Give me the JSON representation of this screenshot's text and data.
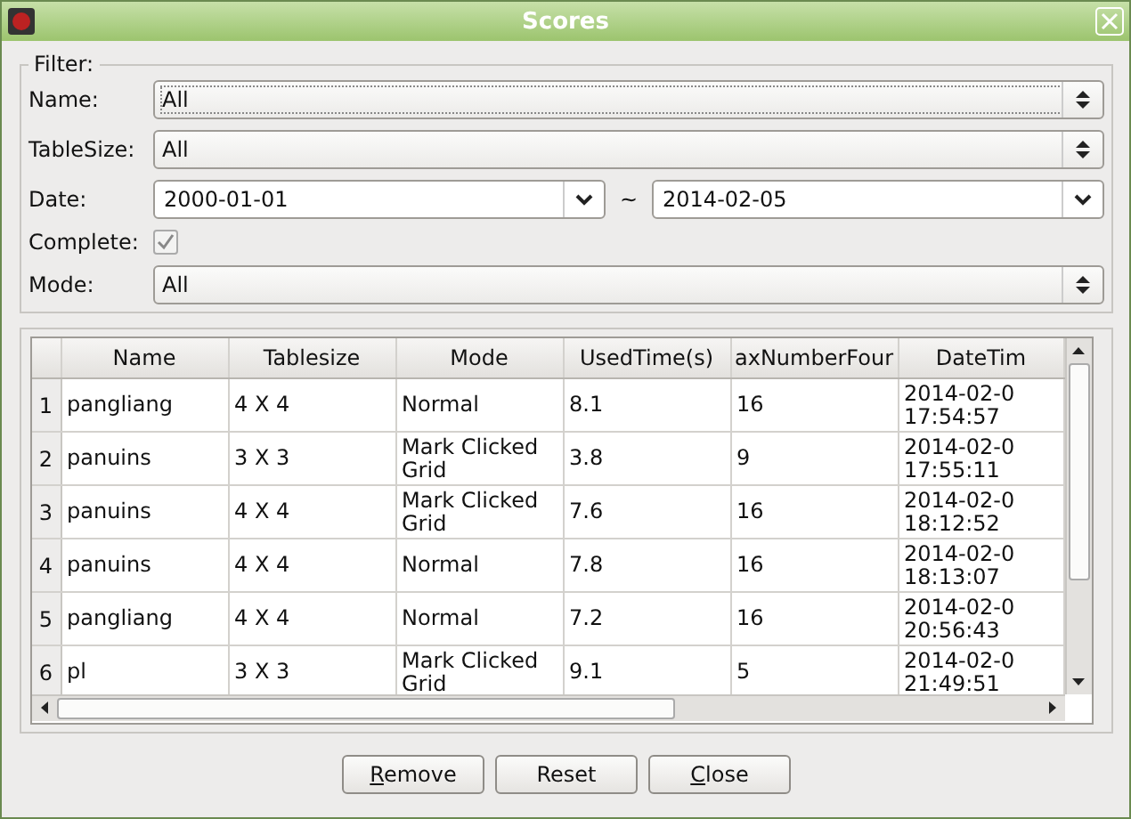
{
  "window": {
    "title": "Scores"
  },
  "filter": {
    "title": "Filter:",
    "name": {
      "label": "Name:",
      "value": "All"
    },
    "table_size": {
      "label": "TableSize:",
      "value": "All"
    },
    "date": {
      "label": "Date:",
      "from": "2000-01-01",
      "separator": "~",
      "to": "2014-02-05"
    },
    "complete": {
      "label": "Complete:",
      "checked": true
    },
    "mode": {
      "label": "Mode:",
      "value": "All"
    }
  },
  "table": {
    "columns": [
      "Name",
      "Tablesize",
      "Mode",
      "UsedTime(s)",
      "axNumberFour",
      "DateTim"
    ],
    "rows": [
      {
        "number": "1",
        "cells": [
          "pangliang",
          "4 X 4",
          "Normal",
          "8.1",
          "16",
          "2014-02-0\n17:54:57"
        ]
      },
      {
        "number": "2",
        "cells": [
          "panuins",
          "3 X 3",
          "Mark Clicked Grid",
          "3.8",
          "9",
          "2014-02-0\n17:55:11"
        ]
      },
      {
        "number": "3",
        "cells": [
          "panuins",
          "4 X 4",
          "Mark Clicked Grid",
          "7.6",
          "16",
          "2014-02-0\n18:12:52"
        ]
      },
      {
        "number": "4",
        "cells": [
          "panuins",
          "4 X 4",
          "Normal",
          "7.8",
          "16",
          "2014-02-0\n18:13:07"
        ]
      },
      {
        "number": "5",
        "cells": [
          "pangliang",
          "4 X 4",
          "Normal",
          "7.2",
          "16",
          "2014-02-0\n20:56:43"
        ]
      },
      {
        "number": "6",
        "cells": [
          "pl",
          "3 X 3",
          "Mark Clicked Grid",
          "9.1",
          "5",
          "2014-02-0\n21:49:51"
        ]
      }
    ]
  },
  "buttons": [
    {
      "label": "Remove",
      "first_letter_underlined": true
    },
    {
      "label": "Reset",
      "first_letter_underlined": false
    },
    {
      "label": "Close",
      "first_letter_underlined": true
    }
  ]
}
